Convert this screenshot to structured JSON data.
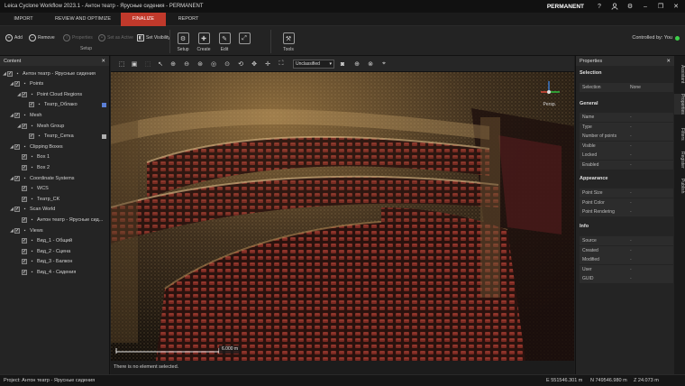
{
  "app": {
    "title": "Leica Cyclone Workflow 2023.1 - Антон театр - Ярусные сидения - PERMANENT",
    "license": "PERMANENT"
  },
  "window_controls": {
    "help_icon": "?",
    "account_icon": "user",
    "settings_icon": "gear",
    "minimize": "–",
    "restore": "❐",
    "close": "✕"
  },
  "ribbon_tabs": [
    {
      "label": "IMPORT",
      "active": false
    },
    {
      "label": "REVIEW AND OPTIMIZE",
      "active": false
    },
    {
      "label": "FINALIZE",
      "active": true
    },
    {
      "label": "REPORT",
      "active": false
    }
  ],
  "toolbar": {
    "add": "Add",
    "remove": "Remove",
    "properties": "Properties",
    "set_as_active": "Set as Active",
    "set_visibility": "Set Visibility",
    "setup_group": "Setup",
    "big_buttons": [
      {
        "label": "Setup",
        "icon": "setup-icon"
      },
      {
        "label": "Create",
        "icon": "create-icon"
      },
      {
        "label": "Edit",
        "icon": "edit-icon"
      },
      {
        "label": "",
        "icon": "edit-alt-icon"
      },
      {
        "label": "Tools",
        "icon": "tools-icon"
      }
    ],
    "controlled_by": "Controlled by: You",
    "status_color": "#3ecf4a"
  },
  "content_panel": {
    "title": "Content",
    "tree": [
      {
        "label": "Антон театр - Ярусные сидения",
        "level": 0,
        "expanded": true,
        "icon": "project-icon"
      },
      {
        "label": "Points",
        "level": 1,
        "expanded": true,
        "icon": "points-icon"
      },
      {
        "label": "Point Cloud Regions",
        "level": 2,
        "expanded": true,
        "icon": "region-icon"
      },
      {
        "label": "Театр_Облако",
        "level": 3,
        "icon": "cloud-icon",
        "swatch": "#5b7fd6"
      },
      {
        "label": "Mesh",
        "level": 1,
        "expanded": true,
        "icon": "mesh-icon"
      },
      {
        "label": "Mesh Group",
        "level": 2,
        "expanded": true,
        "icon": "mesh-group-icon"
      },
      {
        "label": "Театр_Сетка",
        "level": 3,
        "icon": "mesh-item-icon",
        "swatch": "#b0b0b0"
      },
      {
        "label": "Clipping Boxes",
        "level": 1,
        "expanded": true,
        "icon": "clip-icon"
      },
      {
        "label": "Box 1",
        "level": 2,
        "icon": "box-icon"
      },
      {
        "label": "Box 2",
        "level": 2,
        "icon": "box-icon"
      },
      {
        "label": "Coordinate Systems",
        "level": 1,
        "expanded": true,
        "icon": "coord-icon"
      },
      {
        "label": "WCS",
        "level": 2,
        "icon": "wcs-icon"
      },
      {
        "label": "Театр_CK",
        "level": 2,
        "icon": "cs-icon"
      },
      {
        "label": "Scan World",
        "level": 1,
        "expanded": true,
        "icon": "scanworld-icon"
      },
      {
        "label": "Антон театр - Ярусные сид...",
        "level": 2,
        "icon": "scan-icon"
      },
      {
        "label": "Views",
        "level": 1,
        "expanded": true,
        "icon": "views-icon"
      },
      {
        "label": "Вид_1 - Общий",
        "level": 2,
        "icon": "view-icon"
      },
      {
        "label": "Вид_2 - Сцена",
        "level": 2,
        "icon": "view-icon"
      },
      {
        "label": "Вид_3 - Балкон",
        "level": 2,
        "icon": "view-icon"
      },
      {
        "label": "Вид_4 - Сидения",
        "level": 2,
        "icon": "view-icon"
      }
    ]
  },
  "viewport": {
    "classification": "Unclassified",
    "projection": "Persp.",
    "scale_label": "6.000 m",
    "status_message": "There is no element selected."
  },
  "properties_panel": {
    "title": "Properties",
    "selection_header": "Selection",
    "selection": {
      "label": "Selection",
      "value": "None"
    },
    "general_header": "General",
    "general": [
      {
        "label": "Name",
        "value": "-"
      },
      {
        "label": "Type",
        "value": "-"
      },
      {
        "label": "Number of points",
        "value": "-"
      },
      {
        "label": "Visible",
        "value": "-"
      },
      {
        "label": "Locked",
        "value": "-"
      },
      {
        "label": "Enabled",
        "value": "-"
      }
    ],
    "appearance_header": "Appearance",
    "appearance": [
      {
        "label": "Point Size",
        "value": "-"
      },
      {
        "label": "Point Color",
        "value": "-"
      },
      {
        "label": "Point Rendering",
        "value": "-"
      }
    ],
    "info_header": "Info",
    "info": [
      {
        "label": "Source",
        "value": "-"
      },
      {
        "label": "Created",
        "value": "-"
      },
      {
        "label": "Modified",
        "value": "-"
      },
      {
        "label": "User",
        "value": "-"
      },
      {
        "label": "GUID",
        "value": "-"
      }
    ]
  },
  "side_tabs": [
    "Assistant",
    "Properties",
    "Filters",
    "Register",
    "Publish"
  ],
  "statusbar": {
    "project": "Project: Антон театр - Ярусные сидения",
    "e": "E 551546.301 m",
    "n": "N 749546.980 m",
    "z": "Z 24.073 m"
  }
}
